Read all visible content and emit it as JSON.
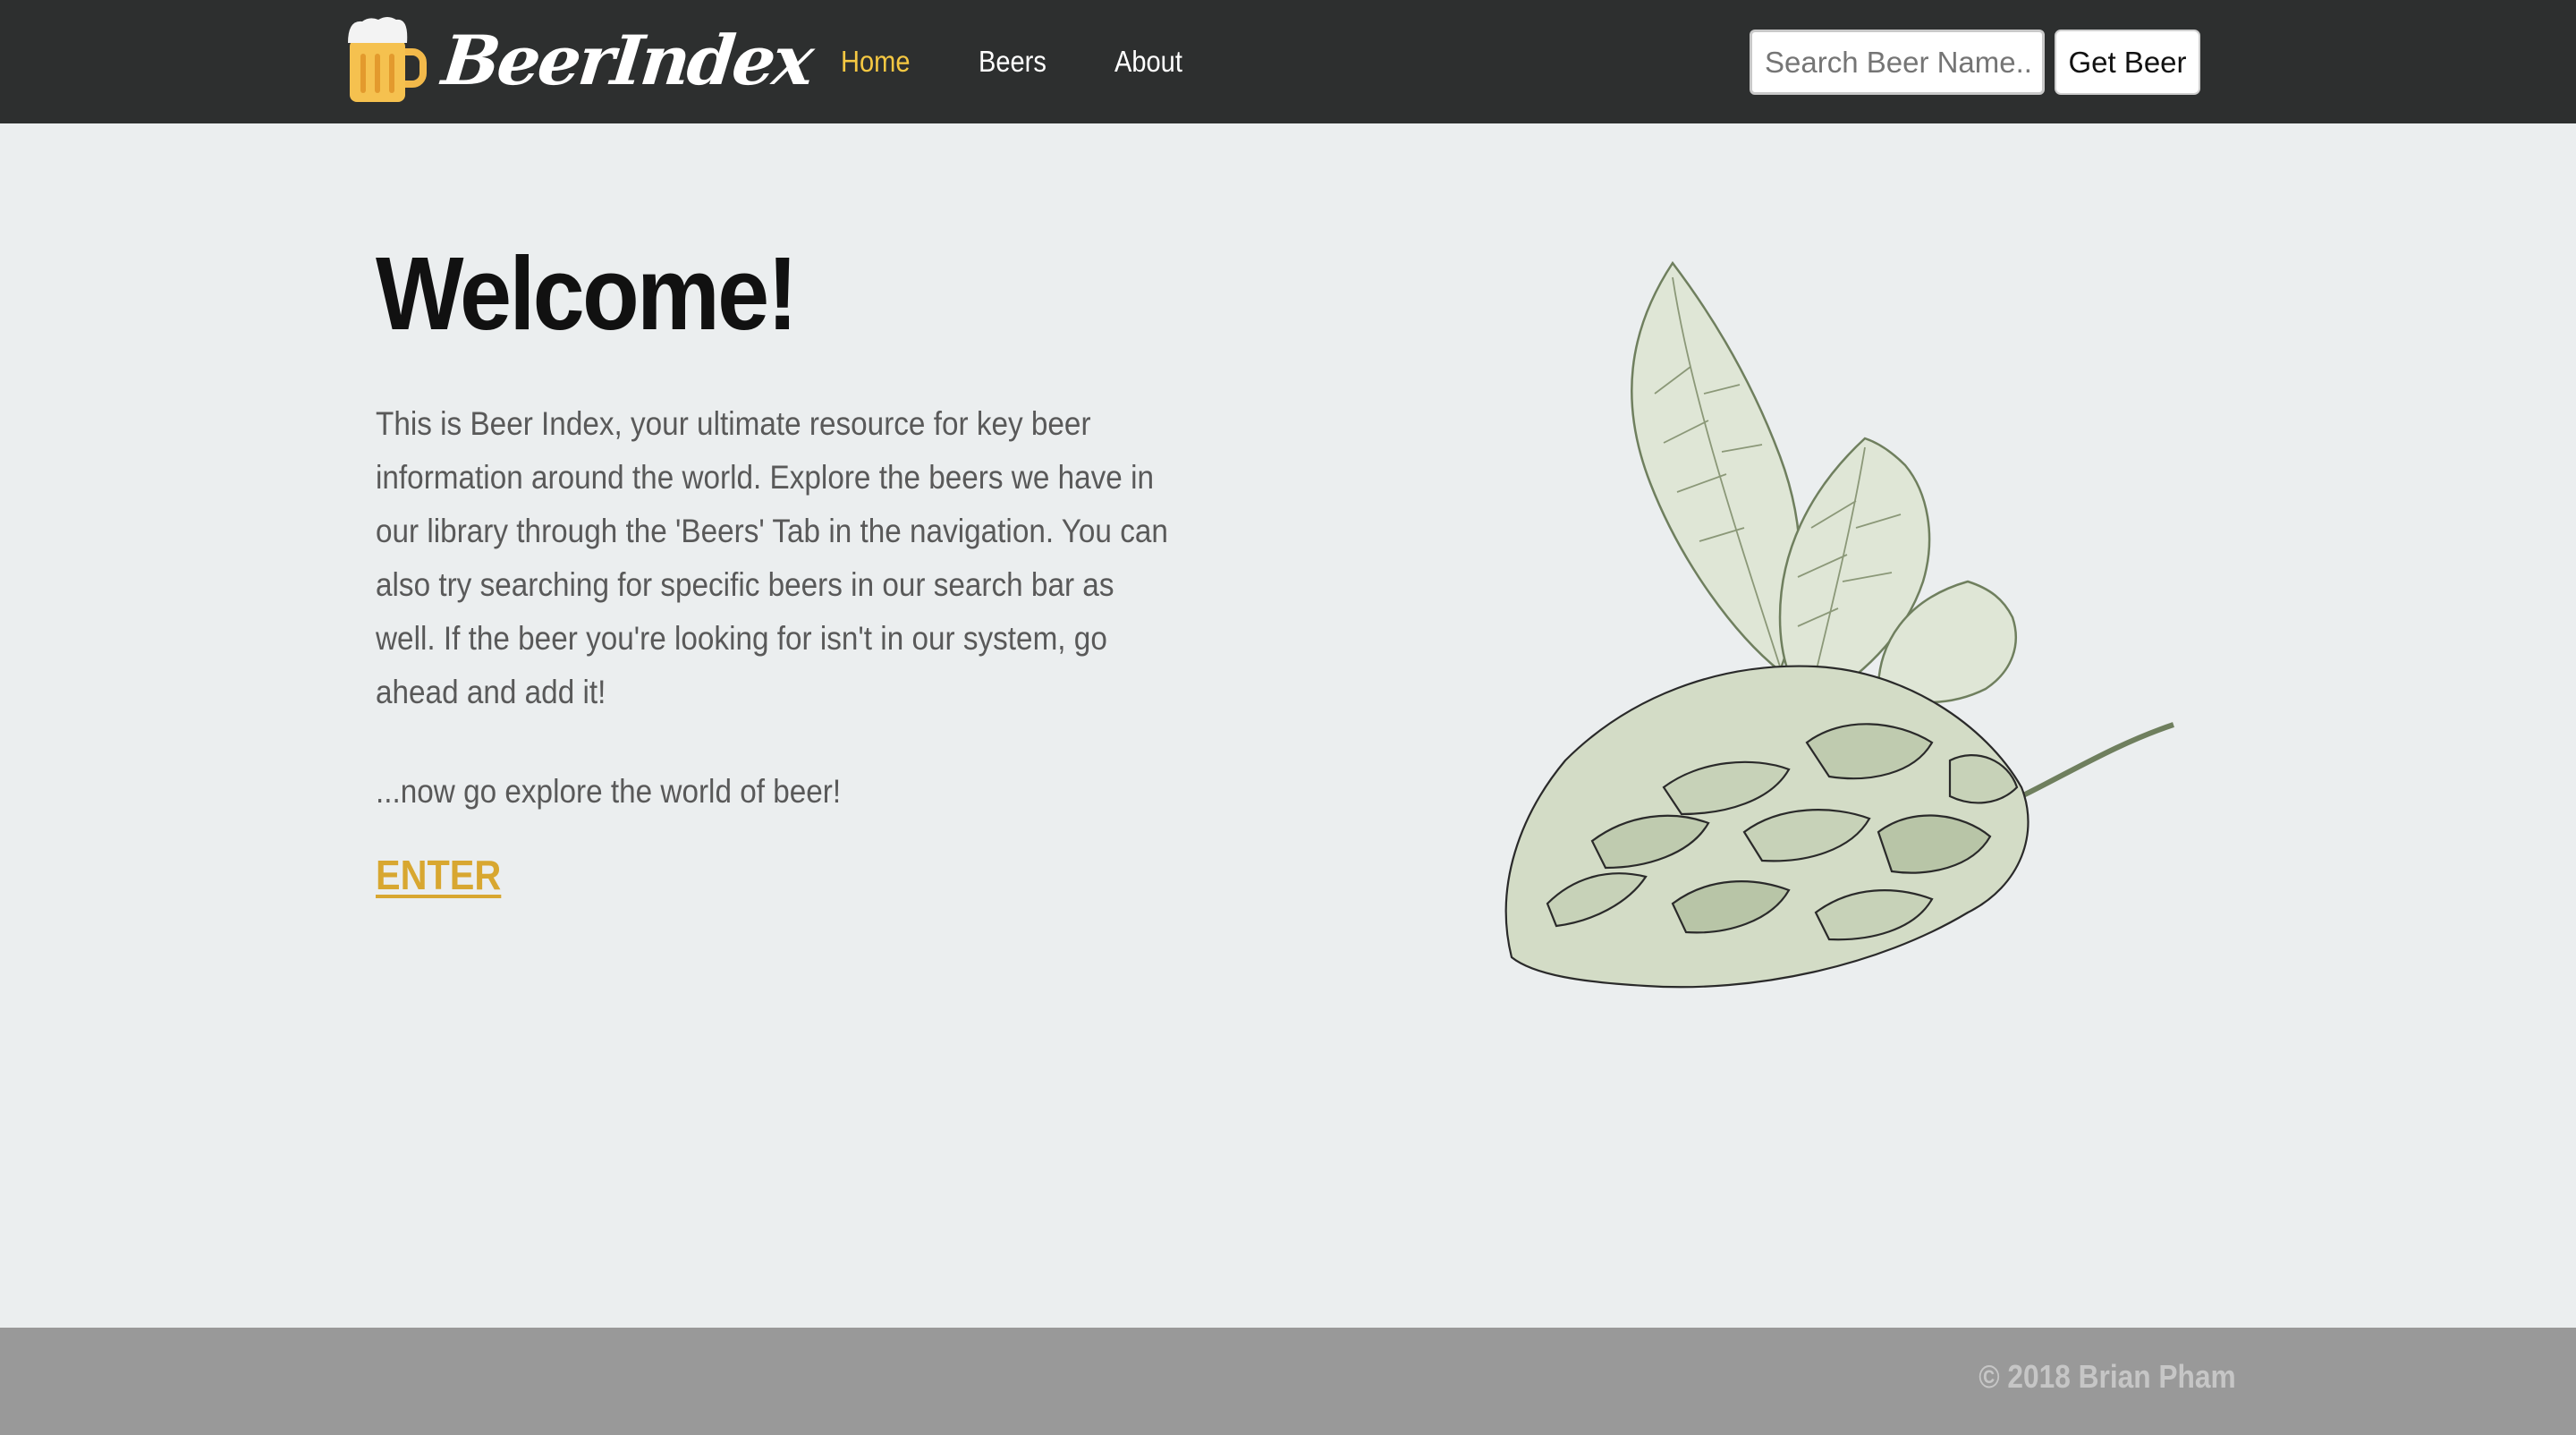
{
  "navbar": {
    "brand_name": "BeerIndex",
    "brand_icon": "beer-mug-icon",
    "links": [
      {
        "label": "Home",
        "active": true
      },
      {
        "label": "Beers",
        "active": false
      },
      {
        "label": "About",
        "active": false
      }
    ],
    "search": {
      "placeholder": "Search Beer Name...",
      "value": ""
    },
    "search_button_label": "Get Beer"
  },
  "main": {
    "heading": "Welcome!",
    "intro": "This is Beer Index, your ultimate resource for key beer information around the world. Explore the beers we have in our library through the 'Beers' Tab in the navigation. You can also try searching for specific beers in our search bar as well. If the beer you're looking for isn't in our system, go ahead and add it!",
    "explore_text": "...now go explore the world of beer!",
    "enter_link": "ENTER",
    "illustration": "hop-cone-illustration"
  },
  "footer": {
    "copyright": "© 2018 Brian Pham"
  },
  "colors": {
    "navbar_bg": "#2d2f2f",
    "page_bg": "#ebeeef",
    "accent_active": "#f5c842",
    "enter_link": "#d8a730",
    "footer_bg": "#999999"
  }
}
